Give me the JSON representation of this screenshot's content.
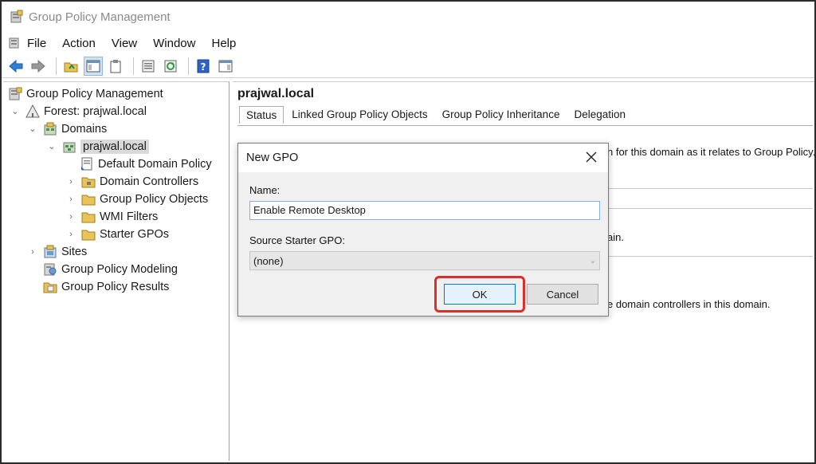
{
  "window": {
    "title": "Group Policy Management"
  },
  "menu": {
    "items": [
      "File",
      "Action",
      "View",
      "Window",
      "Help"
    ]
  },
  "toolbar": {
    "icons": [
      "back-icon",
      "forward-icon",
      "up-folder-icon",
      "show-hide-console-tree-icon",
      "clipboard-icon",
      "properties-icon",
      "refresh-icon",
      "help-icon",
      "action-pane-icon"
    ]
  },
  "tree": {
    "items": [
      {
        "label": "Group Policy Management"
      },
      {
        "label": "Forest: prajwal.local"
      },
      {
        "label": "Domains"
      },
      {
        "label": "prajwal.local"
      },
      {
        "label": "Default Domain Policy"
      },
      {
        "label": "Domain Controllers"
      },
      {
        "label": "Group Policy Objects"
      },
      {
        "label": "WMI Filters"
      },
      {
        "label": "Starter GPOs"
      },
      {
        "label": "Sites"
      },
      {
        "label": "Group Policy Modeling"
      },
      {
        "label": "Group Policy Results"
      }
    ]
  },
  "right": {
    "heading": "prajwal.local",
    "tabs": [
      "Status",
      "Linked Group Policy Objects",
      "Group Policy Inheritance",
      "Delegation"
    ],
    "fragments": [
      "n for this domain as it relates to Group Policy.",
      "ain.",
      "e domain controllers in this domain."
    ]
  },
  "dialog": {
    "title": "New GPO",
    "name_label": "Name:",
    "name_value": "Enable Remote Desktop",
    "starter_label": "Source Starter GPO:",
    "starter_value": "(none)",
    "ok_label": "OK",
    "cancel_label": "Cancel"
  },
  "colors": {
    "highlight": "#d9302c",
    "accent": "#0078d7"
  }
}
